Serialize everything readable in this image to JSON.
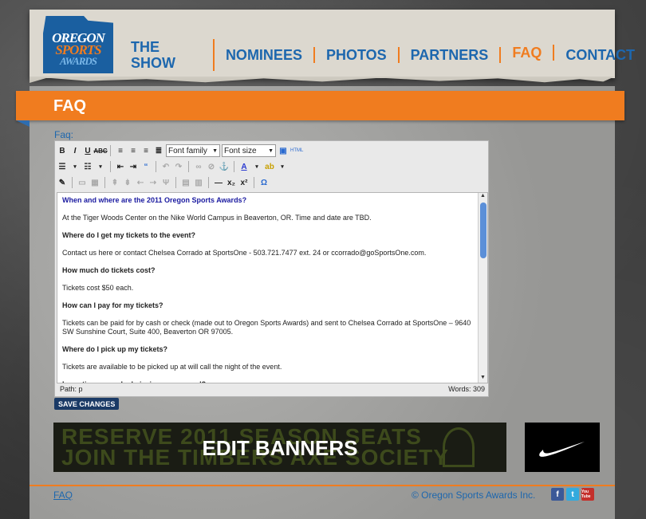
{
  "logo": {
    "line1": "OREGON",
    "line2": "SPORTS",
    "line3": "AWARDS"
  },
  "nav": [
    "THE SHOW",
    "NOMINEES",
    "PHOTOS",
    "PARTNERS",
    "FAQ",
    "CONTACT"
  ],
  "page": {
    "title": "FAQ",
    "field_label": "Faq:"
  },
  "editor": {
    "font_family": "Font family",
    "font_size": "Font size",
    "html_label": "HTML",
    "path": "Path: p",
    "words": "Words: 309",
    "content": [
      {
        "type": "q",
        "style": "blue",
        "text": "When and where are the 2011 Oregon Sports Awards?"
      },
      {
        "type": "a",
        "text": "At the Tiger Woods Center on the Nike World Campus in Beaverton, OR. Time and date are TBD."
      },
      {
        "type": "q",
        "text": "Where do I get my tickets to the event?"
      },
      {
        "type": "a",
        "text": "Contact us here or contact Chelsea Corrado at SportsOne - 503.721.7477 ext. 24 or ccorrado@goSportsOne.com."
      },
      {
        "type": "q",
        "text": "How much do tickets cost?"
      },
      {
        "type": "a",
        "text": "Tickets cost $50 each."
      },
      {
        "type": "q",
        "text": "How can I pay for my tickets?"
      },
      {
        "type": "a",
        "text": "Tickets can be paid for by cash or check (made out to Oregon Sports Awards) and sent to Chelsea Corrado at SportsOne – 9640 SW Sunshine Court, Suite 400, Beaverton OR 97005."
      },
      {
        "type": "q",
        "text": "Where do I pick up my tickets?"
      },
      {
        "type": "a",
        "text": "Tickets are available to be picked up at will call the night of the event."
      },
      {
        "type": "q",
        "text": "Is seating general admission or reserved?"
      }
    ]
  },
  "save_label": "SAVE CHANGES",
  "ad": {
    "bg_line1": "RESERVE 2011 SEASON SEATS",
    "bg_line2": "JOIN THE TIMBERS AXE SOCIETY",
    "overlay": "EDIT BANNERS"
  },
  "footer": {
    "link": "FAQ",
    "copyright": "© Oregon Sports Awards Inc."
  },
  "social": [
    {
      "icon": "facebook-icon",
      "glyph": "f",
      "color": "#3b5998"
    },
    {
      "icon": "twitter-icon",
      "glyph": "t",
      "color": "#33aadd"
    },
    {
      "icon": "youtube-icon",
      "glyph": "You Tube",
      "color": "#c4302b"
    }
  ],
  "colors": {
    "accent": "#f07c1f",
    "link": "#1d67ae"
  }
}
